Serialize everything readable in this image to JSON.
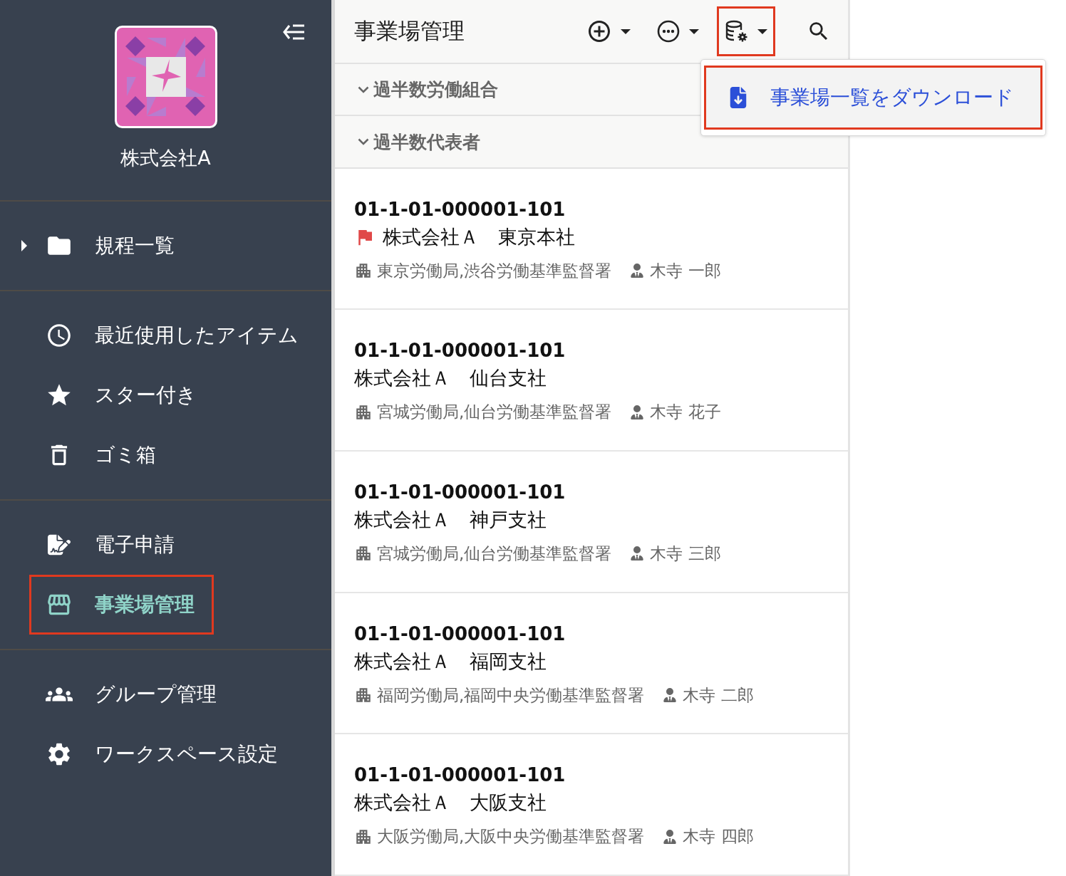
{
  "sidebar": {
    "company": "株式会社A",
    "sections": [
      [
        {
          "label": "規程一覧",
          "expandable": true,
          "selected": false,
          "highlighted": false
        }
      ],
      [
        {
          "label": "最近使用したアイテム",
          "selected": false,
          "highlighted": false
        },
        {
          "label": "スター付き",
          "selected": false,
          "highlighted": false
        },
        {
          "label": "ゴミ箱",
          "selected": false,
          "highlighted": false
        }
      ],
      [
        {
          "label": "電子申請",
          "selected": false,
          "highlighted": false
        },
        {
          "label": "事業場管理",
          "selected": true,
          "highlighted": true
        }
      ],
      [
        {
          "label": "グループ管理",
          "selected": false,
          "highlighted": false
        },
        {
          "label": "ワークスペース設定",
          "selected": false,
          "highlighted": false
        }
      ]
    ]
  },
  "toolbar": {
    "title": "事業場管理",
    "buttons": [
      {
        "highlighted": false
      },
      {
        "highlighted": false
      },
      {
        "highlighted": true
      }
    ],
    "menu": [
      {
        "label": "事業場一覧をダウンロード",
        "highlighted": true
      }
    ]
  },
  "groups": [
    {
      "label": "過半数労働組合"
    },
    {
      "label": "過半数代表者"
    }
  ],
  "sites": [
    {
      "code": "01-1-01-000001-101",
      "name": "株式会社Ａ　東京本社",
      "flagged": true,
      "bureau": "東京労働局,渋谷労働基準監督署",
      "person": "木寺 一郎"
    },
    {
      "code": "01-1-01-000001-101",
      "name": "株式会社Ａ　仙台支社",
      "flagged": false,
      "bureau": "宮城労働局,仙台労働基準監督署",
      "person": "木寺 花子"
    },
    {
      "code": "01-1-01-000001-101",
      "name": "株式会社Ａ　神戸支社",
      "flagged": false,
      "bureau": "宮城労働局,仙台労働基準監督署",
      "person": "木寺 三郎"
    },
    {
      "code": "01-1-01-000001-101",
      "name": "株式会社Ａ　福岡支社",
      "flagged": false,
      "bureau": "福岡労働局,福岡中央労働基準監督署",
      "person": "木寺 二郎"
    },
    {
      "code": "01-1-01-000001-101",
      "name": "株式会社Ａ　大阪支社",
      "flagged": false,
      "bureau": "大阪労働局,大阪中央労働基準監督署",
      "person": "木寺 四郎"
    }
  ]
}
